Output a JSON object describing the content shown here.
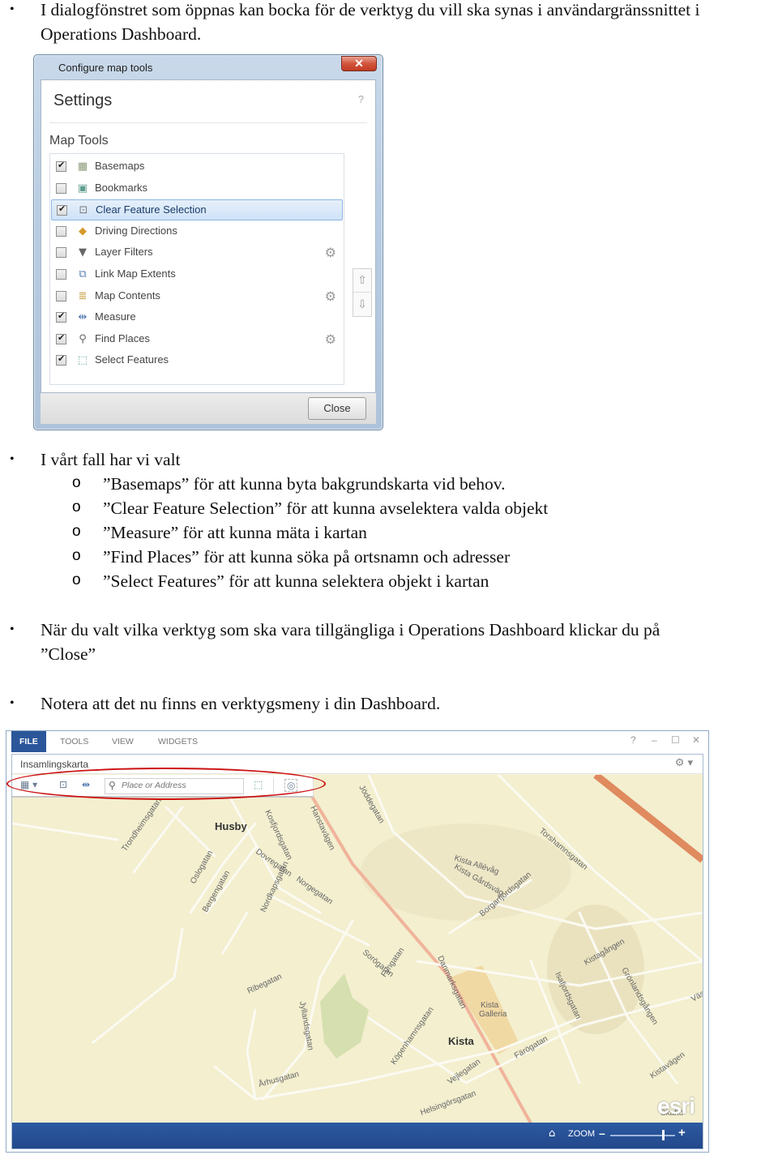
{
  "document": {
    "intro": {
      "line1": "I dialogfönstret som öppnas kan bocka för de verktyg du vill ska synas i användargränssnittet i",
      "line2": "Operations Dashboard."
    },
    "choices": {
      "heading": "I vårt fall har vi valt",
      "items": [
        "”Basemaps” för att kunna byta bakgrundskarta vid behov.",
        "”Clear Feature Selection” för att kunna avselektera valda objekt",
        "”Measure” för att kunna mäta i kartan",
        "”Find Places” för att kunna söka på ortsnamn och adresser",
        "”Select Features” för att kunna selektera objekt i kartan"
      ]
    },
    "close_note": {
      "line1": "När du valt vilka verktyg som ska vara tillgängliga i Operations Dashboard klickar du på",
      "line2": "”Close”"
    },
    "toolbar_note": "Notera att det nu finns en verktygsmeny i din Dashboard.",
    "bullet_glyph": "•",
    "sub_bullet_glyph": "o"
  },
  "dialog": {
    "window_title": "Configure map tools",
    "close_x": "✕",
    "heading": "Settings",
    "help": "?",
    "section": "Map Tools",
    "tools": [
      {
        "label": "Basemaps",
        "checked": true,
        "icon": "basemaps-icon",
        "glyph": "▦",
        "color": "#8a9a7a",
        "gear": false
      },
      {
        "label": "Bookmarks",
        "checked": false,
        "icon": "bookmarks-icon",
        "glyph": "▣",
        "color": "#5f9d8f",
        "gear": false
      },
      {
        "label": "Clear Feature Selection",
        "checked": true,
        "icon": "clear-selection-icon",
        "glyph": "⊡",
        "color": "#777777",
        "gear": false,
        "selected": true
      },
      {
        "label": "Driving Directions",
        "checked": false,
        "icon": "driving-directions-icon",
        "glyph": "◆",
        "color": "#d69a2d",
        "gear": false
      },
      {
        "label": "Layer Filters",
        "checked": false,
        "icon": "filter-icon",
        "glyph": "▼",
        "color": "#666666",
        "gear": true
      },
      {
        "label": "Link Map Extents",
        "checked": false,
        "icon": "link-extents-icon",
        "glyph": "⧉",
        "color": "#5a7fb0",
        "gear": false
      },
      {
        "label": "Map Contents",
        "checked": false,
        "icon": "map-contents-icon",
        "glyph": "≣",
        "color": "#c9a24a",
        "gear": true
      },
      {
        "label": "Measure",
        "checked": true,
        "icon": "measure-icon",
        "glyph": "⇹",
        "color": "#4b74ad",
        "gear": false
      },
      {
        "label": "Find Places",
        "checked": true,
        "icon": "search-icon",
        "glyph": "⚲",
        "color": "#666666",
        "gear": true
      },
      {
        "label": "Select Features",
        "checked": true,
        "icon": "select-features-icon",
        "glyph": "⬚",
        "color": "#5e9c9a",
        "gear": false
      }
    ],
    "move_up": "⇧",
    "move_down": "⇩",
    "gear_glyph": "⚙",
    "close_button": "Close"
  },
  "dashboard": {
    "menu": [
      "FILE",
      "TOOLS",
      "VIEW",
      "WIDGETS"
    ],
    "window_controls": {
      "help": "?",
      "minimize": "–",
      "maximize": "☐",
      "close": "✕"
    },
    "map_title": "Insamlingskarta",
    "map_settings": "⚙ ▾",
    "toolbar": {
      "basemaps": "▦ ▾",
      "clear_selection": "⊡",
      "measure": "⇹",
      "search_icon": "⚲",
      "search_placeholder": "Place or Address",
      "select_features": "⬚",
      "locate": "◎"
    },
    "map_labels": {
      "places": [
        "Husby",
        "Kista"
      ],
      "poi": [
        "Kista",
        "Galleria"
      ],
      "streets": [
        "Trondheimsgatan",
        "Oslogatan",
        "Kosfjordsgatan",
        "Hanstavägen",
        "Jöddegatan",
        "Dovregatan",
        "Norgegatan",
        "Bergengatan",
        "Nordkapsgatan",
        "Torshamnsgatan",
        "Kista Allévåg",
        "Kista Gårdsväg",
        "Borgarfjordsgatan",
        "Sorögatan",
        "Fyngatan",
        "Danmarksgatan",
        "Ribegatan",
        "Jyllandsgatan",
        "Köpenhamnsgatan",
        "Färögatan",
        "Isafjordsgatan",
        "Kistagången",
        "Grönlandsgången",
        "Århusgatan",
        "Vejlegatan",
        "Helsingörsgatan",
        "Kistavägen",
        "Skaftö",
        "Väs"
      ]
    },
    "footer": {
      "home": "⌂",
      "zoom_label": "ZOOM",
      "zoom_minus": "–",
      "zoom_plus": "+",
      "zoom_level": 0.8
    },
    "logo": "esri",
    "colors": {
      "menu_active": "#2b579a",
      "footer": "#22488a",
      "highlight": "#cc1111",
      "map_bg": "#f3efcf",
      "highway": "#e08a5f"
    }
  }
}
